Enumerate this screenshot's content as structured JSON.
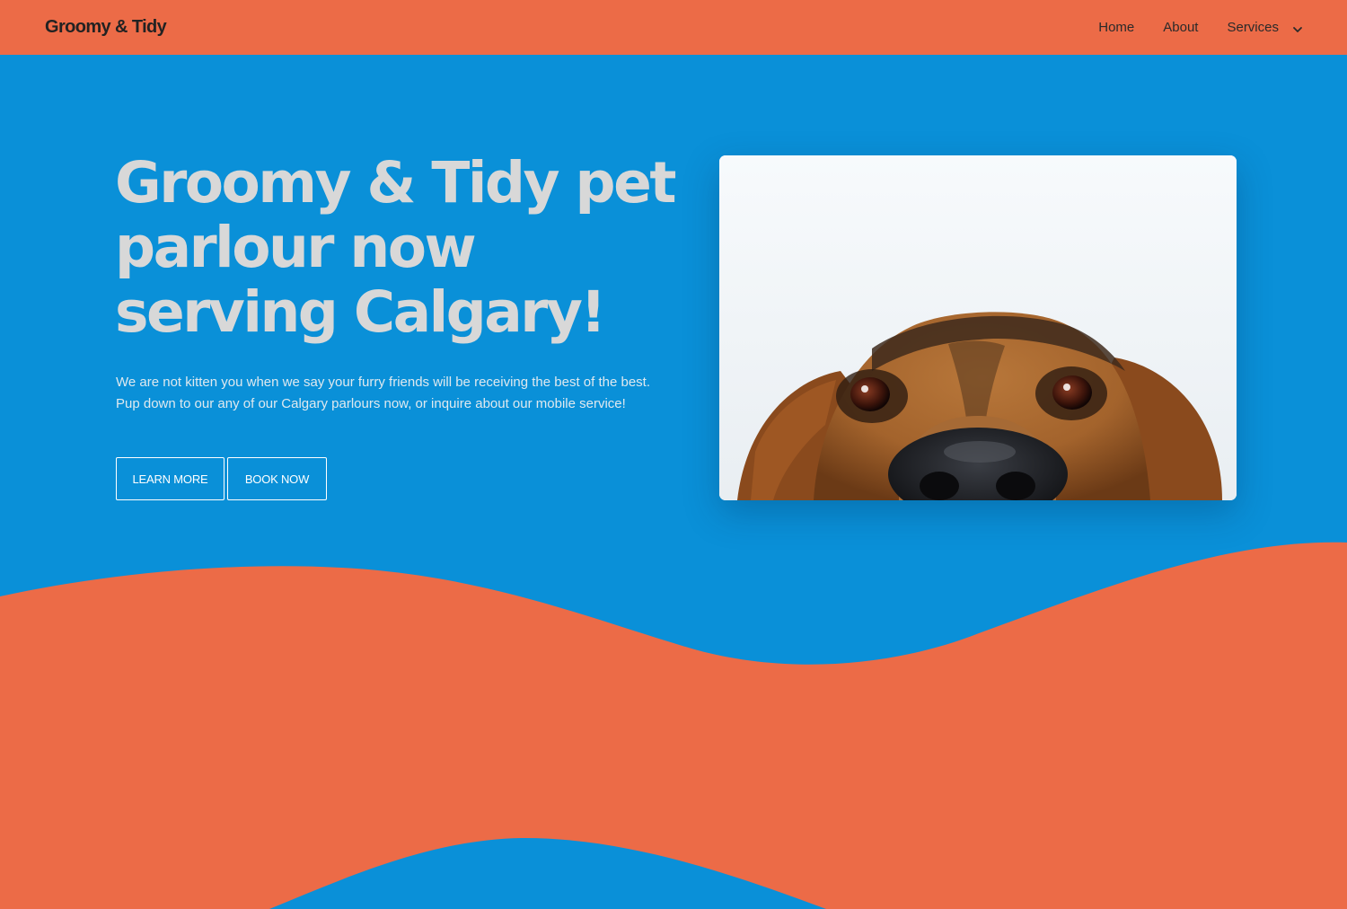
{
  "brand": "Groomy & Tidy",
  "nav": {
    "home": "Home",
    "about": "About",
    "services": "Services"
  },
  "hero": {
    "title": "Groomy & Tidy pet parlour now serving Calgary!",
    "description_line1": "We are not kitten you when we say your furry friends will be receiving the best of the best.",
    "description_line2": "Pup down to our any of our Calgary parlours now, or inquire about our mobile service!",
    "learn_more": "LEARN MORE",
    "book_now": "BOOK NOW",
    "image": "dog-peeking-photo"
  },
  "colors": {
    "primary_blue": "#0a90d8",
    "accent_orange": "#ec6b47",
    "title_gray": "#d8d8d8"
  },
  "icons": {
    "services_dropdown": "chevron-down-icon"
  }
}
